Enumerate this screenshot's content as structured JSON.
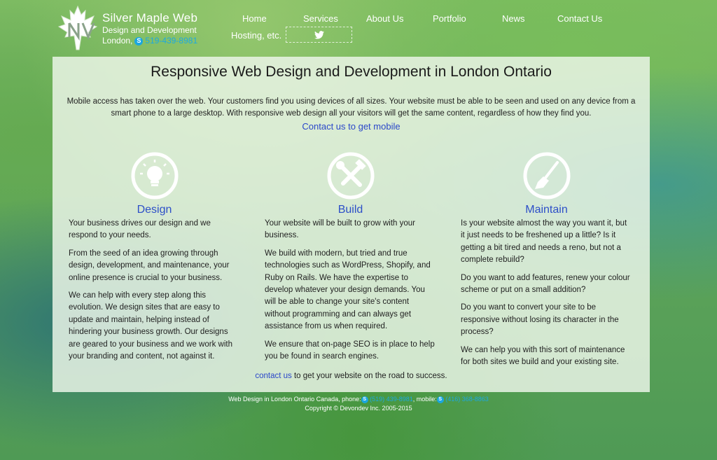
{
  "header": {
    "brand_name": "Silver Maple Web",
    "brand_tagline": "Design and Development",
    "brand_city": "London,",
    "brand_phone": "519-439-8981",
    "nav": [
      {
        "label": "Home"
      },
      {
        "label": "Services"
      },
      {
        "label": "About Us"
      },
      {
        "label": "Portfolio"
      },
      {
        "label": "News"
      },
      {
        "label": "Contact Us"
      },
      {
        "label": "Hosting, etc."
      }
    ]
  },
  "main": {
    "title": "Responsive Web Design and Development in London Ontario",
    "intro": "Mobile access has taken over the web. Your customers find you using devices of all sizes. Your website must be able to be seen and used on any device from a smart phone to a large desktop. With responsive web design all your visitors will get the same content, regardless of how they find you.",
    "cta_link": "Contact us to get mobile",
    "columns": [
      {
        "heading": "Design",
        "icon": "lightbulb-icon",
        "paragraphs": [
          "Your business drives our design and we respond to your needs.",
          "From the seed of an idea growing through design, development, and maintenance, your online presence is crucial to your business.",
          "We can help with every step along this evolution. We design sites that are easy to update and maintain, helping instead of hindering your business growth. Our designs are geared to your business and we work with your branding and content, not against it."
        ]
      },
      {
        "heading": "Build",
        "icon": "tools-icon",
        "paragraphs": [
          "Your website will be built to grow with your business.",
          "We build with modern, but tried and true technologies such as WordPress, Shopify, and Ruby on Rails. We have the expertise to develop whatever your design demands. You will be able to change your site's content without programming and can always get assistance from us when required.",
          "We ensure that on-page SEO is in place to help you be found in search engines."
        ]
      },
      {
        "heading": "Maintain",
        "icon": "brush-icon",
        "paragraphs": [
          "Is your website almost the way you want it, but it just needs to be freshened up a little? Is it getting a bit tired and needs a reno, but not a complete rebuild?",
          "Do you want to add features, renew your colour scheme or put on a small addition?",
          "Do you want to convert your site to be responsive without losing its character in the process?",
          "We can help you with this sort of maintenance for both sites we build and your existing site."
        ]
      }
    ],
    "bottom_link": "contact us",
    "bottom_text": " to get your website on the road to success."
  },
  "footer": {
    "line1_prefix": "Web Design in London Ontario Canada, phone:",
    "phone": "(519) 439-8981",
    "mobile_label": ", mobile:",
    "mobile": "(416) 368-8863",
    "copyright": "Copyright © Devondev Inc. 2005-2015"
  },
  "colors": {
    "link": "#2a47c9",
    "skype": "#1aa7e0",
    "panel": "#ecf6e8"
  }
}
